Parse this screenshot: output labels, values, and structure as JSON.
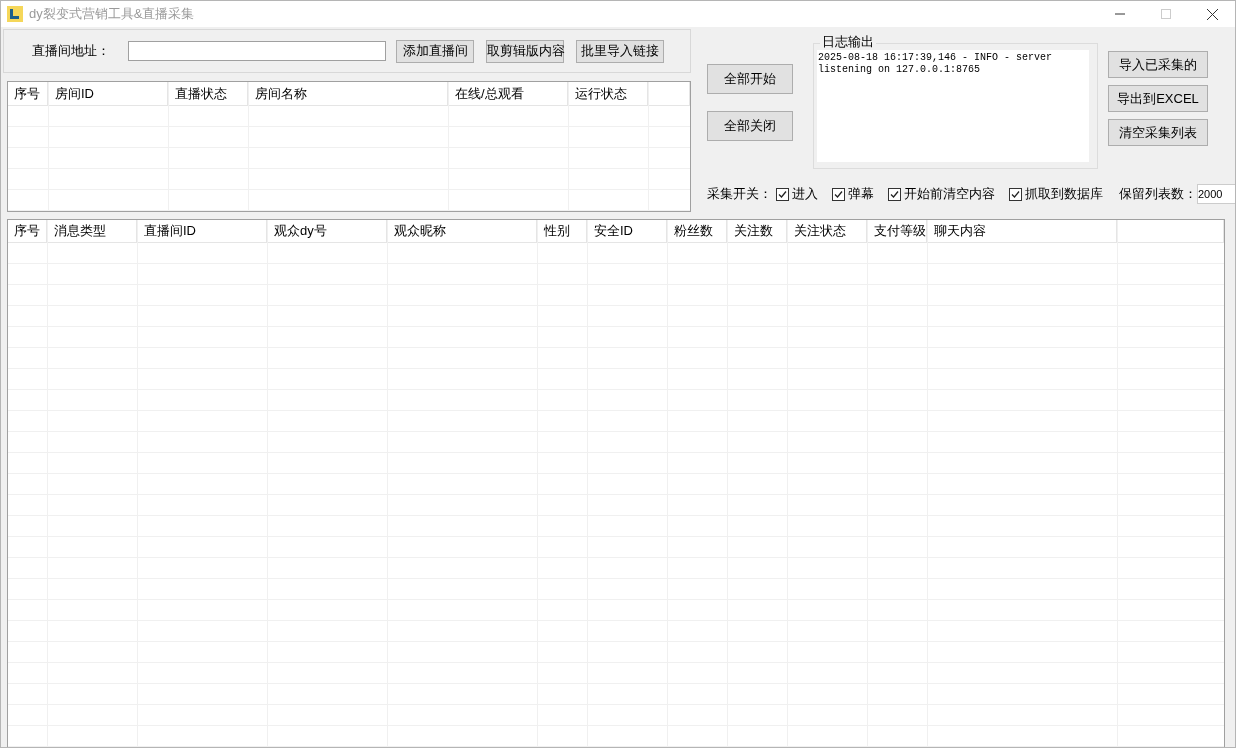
{
  "window": {
    "title": "dy裂变式营销工具&直播采集"
  },
  "address": {
    "label": "直播间地址："
  },
  "top_buttons": [
    "添加直播间",
    "取剪辑版内容",
    "批里导入链接"
  ],
  "room_table": {
    "columns": [
      "序号",
      "房间ID",
      "直播状态",
      "房间名称",
      "在线/总观看",
      "运行状态"
    ]
  },
  "control_buttons": [
    "全部开始",
    "全部关闭"
  ],
  "log": {
    "title": "日志输出",
    "lines": "2025-08-18 16:17:39,146 - INFO - server\nlistening on 127.0.0.1:8765"
  },
  "side_buttons": [
    "导入已采集的",
    "导出到EXCEL",
    "清空采集列表"
  ],
  "switches": {
    "label": "采集开关：",
    "items": [
      {
        "label": "进入",
        "checked": true
      },
      {
        "label": "弹幕",
        "checked": true
      },
      {
        "label": "开始前清空内容",
        "checked": true
      },
      {
        "label": "抓取到数据库",
        "checked": true
      }
    ]
  },
  "keep_count": {
    "label": "保留列表数：",
    "value": "2000"
  },
  "message_table": {
    "columns": [
      "序号",
      "消息类型",
      "直播间ID",
      "观众dy号",
      "观众昵称",
      "性别",
      "安全ID",
      "粉丝数",
      "关注数",
      "关注状态",
      "支付等级",
      "聊天内容"
    ]
  }
}
